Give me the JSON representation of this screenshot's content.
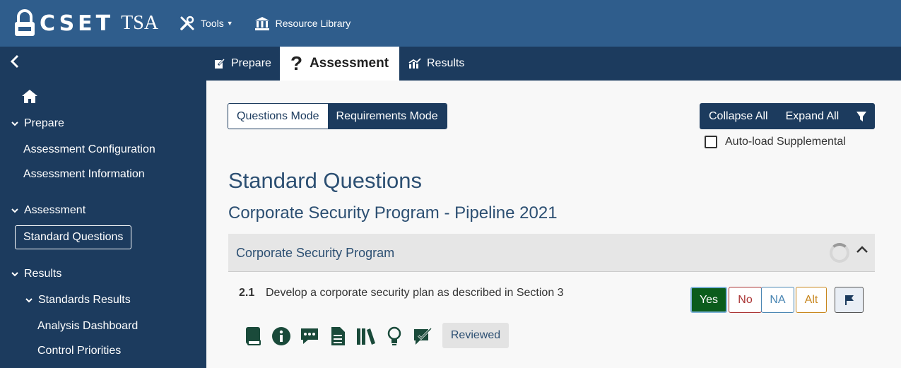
{
  "header": {
    "brand": "CSET",
    "brand_sub": "TSA",
    "tools_label": "Tools",
    "resource_label": "Resource Library"
  },
  "tabs": {
    "prepare": "Prepare",
    "assessment": "Assessment",
    "results": "Results"
  },
  "sidebar": {
    "back": "<",
    "prepare": "Prepare",
    "assessment_configuration": "Assessment Configuration",
    "assessment_information": "Assessment Information",
    "assessment": "Assessment",
    "standard_questions": "Standard Questions",
    "results": "Results",
    "standards_results": "Standards Results",
    "analysis_dashboard": "Analysis Dashboard",
    "control_priorities": "Control Priorities"
  },
  "main": {
    "questions_mode": "Questions Mode",
    "requirements_mode": "Requirements Mode",
    "collapse_all": "Collapse All",
    "expand_all": "Expand All",
    "auto_load": "Auto-load Supplemental",
    "heading": "Standard Questions",
    "subheading": "Corporate Security Program - Pipeline 2021",
    "group_title": "Corporate Security Program",
    "question": {
      "number": "2.1",
      "text": "Develop a corporate security plan as described in Section 3",
      "answers": {
        "yes": "Yes",
        "no": "No",
        "na": "NA",
        "alt": "Alt"
      },
      "selected": "Yes",
      "reviewed": "Reviewed"
    }
  },
  "colors": {
    "topbar": "#2f5d8c",
    "navy": "#1c3b5e",
    "yes": "#0b5c1c",
    "no": "#a33333",
    "na": "#4a86b3",
    "alt": "#c8861d"
  }
}
